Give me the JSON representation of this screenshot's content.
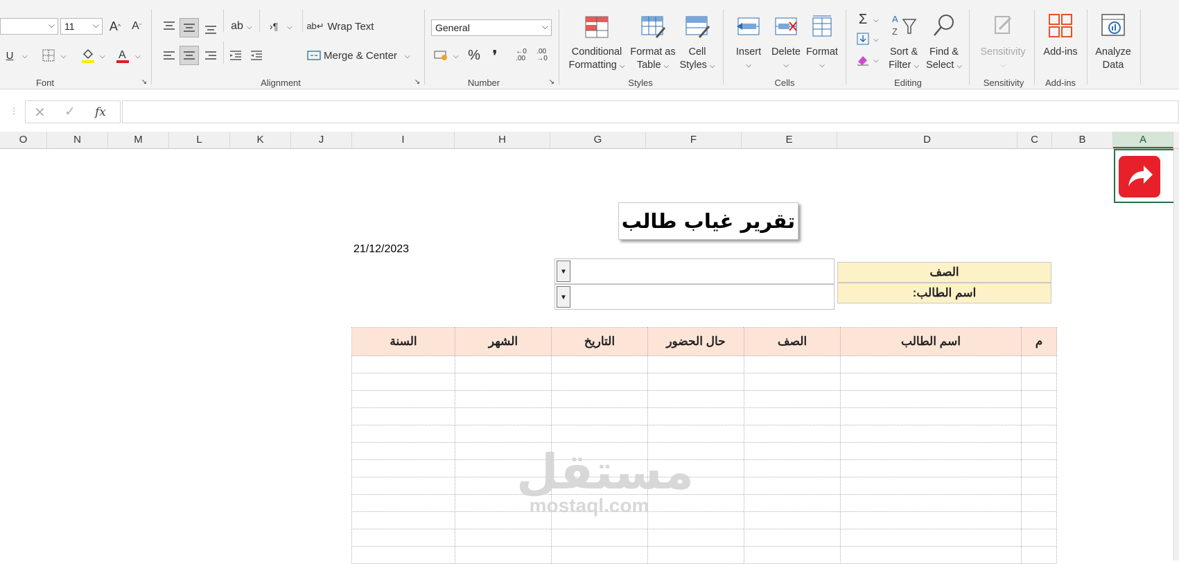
{
  "ribbon": {
    "font": {
      "size_value": "11",
      "group_label": "Font"
    },
    "alignment": {
      "wrap_text": "Wrap Text",
      "merge_center": "Merge & Center",
      "group_label": "Alignment"
    },
    "number": {
      "format_value": "General",
      "group_label": "Number"
    },
    "styles": {
      "conditional_line1": "Conditional",
      "conditional_line2": "Formatting",
      "format_table_line1": "Format as",
      "format_table_line2": "Table",
      "cell_styles_line1": "Cell",
      "cell_styles_line2": "Styles",
      "group_label": "Styles"
    },
    "cells": {
      "insert": "Insert",
      "delete": "Delete",
      "format": "Format",
      "group_label": "Cells"
    },
    "editing": {
      "sort_line1": "Sort &",
      "sort_line2": "Filter",
      "find_line1": "Find &",
      "find_line2": "Select",
      "group_label": "Editing"
    },
    "sensitivity": {
      "label": "Sensitivity",
      "group_label": "Sensitivity"
    },
    "addins": {
      "label": "Add-ins",
      "group_label": "Add-ins"
    },
    "analyze": {
      "line1": "Analyze",
      "line2": "Data"
    }
  },
  "formula_bar": {
    "fx": "fx",
    "content": ""
  },
  "columns": [
    "O",
    "N",
    "M",
    "L",
    "K",
    "J",
    "I",
    "H",
    "G",
    "F",
    "E",
    "D",
    "C",
    "B",
    "A"
  ],
  "sheet": {
    "title": "تقرير غياب طالب",
    "date": "21/12/2023",
    "class_label": "الصف",
    "student_label": "اسم الطالب:",
    "class_value": "",
    "student_value": "",
    "table": {
      "headers": [
        "م",
        "اسم الطالب",
        "الصف",
        "حال الحضور",
        "التاريخ",
        "الشهر",
        "السنة"
      ],
      "rows": 12
    }
  },
  "watermark": {
    "arabic": "مستقل",
    "latin": "mostaql.com"
  },
  "colors": {
    "accent": "#217346",
    "header_fill": "#fce4d6",
    "label_fill": "#fdf1c7",
    "share_button": "#e8202a"
  }
}
